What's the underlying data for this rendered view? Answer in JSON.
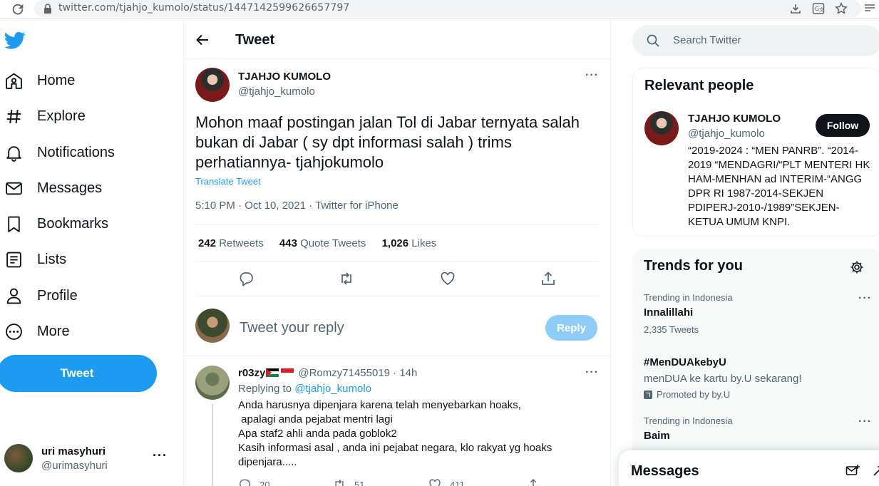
{
  "browser": {
    "url": "twitter.com/tjahjo_kumolo/status/1447142599626657797"
  },
  "nav": {
    "items": [
      {
        "label": "Home",
        "icon": "home-icon"
      },
      {
        "label": "Explore",
        "icon": "hashtag-icon"
      },
      {
        "label": "Notifications",
        "icon": "bell-icon"
      },
      {
        "label": "Messages",
        "icon": "envelope-icon"
      },
      {
        "label": "Bookmarks",
        "icon": "bookmark-icon"
      },
      {
        "label": "Lists",
        "icon": "list-icon"
      },
      {
        "label": "Profile",
        "icon": "person-icon"
      },
      {
        "label": "More",
        "icon": "more-circle-icon"
      }
    ],
    "tweet_button": "Tweet",
    "account": {
      "name": "uri masyhuri",
      "handle": "@urimasyhuri"
    }
  },
  "main": {
    "title": "Tweet",
    "tweet": {
      "author_name": "TJAHJO KUMOLO",
      "author_handle": "@tjahjo_kumolo",
      "text": "Mohon maaf postingan jalan Tol di Jabar ternyata salah bukan di Jabar ( sy dpt informasi salah ) trims perhatiannya- tjahjokumolo",
      "translate": "Translate Tweet",
      "meta": "5:10 PM · Oct 10, 2021 · Twitter for iPhone",
      "stats": {
        "retweets_count": "242",
        "retweets_label": "Retweets",
        "quotes_count": "443",
        "quotes_label": "Quote Tweets",
        "likes_count": "1,026",
        "likes_label": "Likes"
      }
    },
    "reply_box": {
      "placeholder": "Tweet your reply",
      "button": "Reply"
    },
    "reply": {
      "name": "r03zy",
      "handle_time": "@Romzy71455019 · 14h",
      "replying_prefix": "Replying to",
      "replying_to": "@tjahjo_kumolo",
      "body": "Anda harusnya dipenjara karena telah menyebarkan hoaks,\n apalagi anda pejabat mentri lagi\nApa staf2 ahli anda pada goblok2\nKasih informasi asal , anda ini pejabat negara, klo rakyat yg hoaks\ndipenjara.....",
      "reply_count": "20",
      "retweet_count": "51",
      "like_count": "411"
    }
  },
  "right": {
    "search_placeholder": "Search Twitter",
    "relevant": {
      "title": "Relevant people",
      "name": "TJAHJO KUMOLO",
      "handle": "@tjahjo_kumolo",
      "follow": "Follow",
      "bio": "“2019-2024 : “MEN PANRB”. “2014-2019 “MENDAGRI/“PLT MENTERI HK HAM-MENHAN ad INTERIM-“ANGG DPR RI 1987-2014-SEKJEN PDIPERJ-2010-/1989”SEKJEN-KETUA UMUM KNPI."
    },
    "trends": {
      "title": "Trends for you",
      "items": [
        {
          "context": "Trending in Indonesia",
          "name": "Innalillahi",
          "meta": "2,335 Tweets"
        },
        {
          "name": "#MenDUAkebyU",
          "desc": "menDUA ke kartu by.U sekarang!",
          "promo": "Promoted by by.U"
        },
        {
          "context": "Trending in Indonesia",
          "name": "Baim"
        }
      ]
    }
  },
  "messages_drawer": {
    "title": "Messages"
  },
  "colors": {
    "accent": "#1d9bf0",
    "text": "#0f1419",
    "muted": "#536471"
  }
}
